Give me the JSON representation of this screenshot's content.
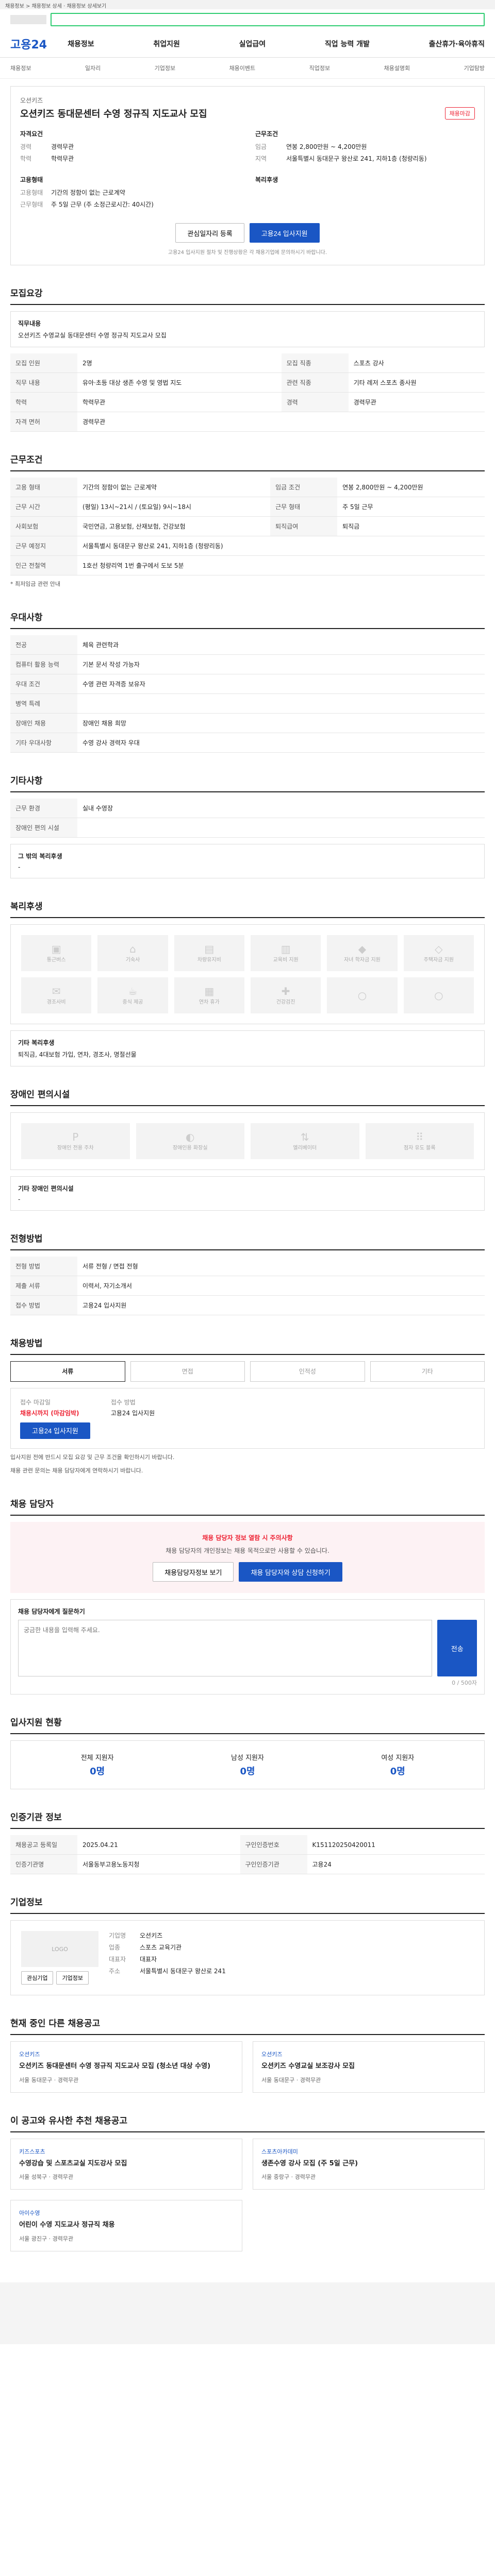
{
  "topbar": {
    "text": "채용정보 > 채용정보 상세 · 채용정보 상세보기"
  },
  "search": {
    "placeholder": ""
  },
  "gnb": {
    "brand": "고용24",
    "menu": [
      "채용정보",
      "취업지원",
      "실업급여",
      "직업 능력 개발",
      "출산휴가·육아휴직"
    ]
  },
  "subnav": [
    "채용정보",
    "일자리",
    "기업정보",
    "채용이벤트",
    "직업정보",
    "채용설명회",
    "기업탐방"
  ],
  "job": {
    "company": "오션키즈",
    "title": "오션키즈 동대문센터 수영 정규직 지도교사 모집",
    "badge": "채용마감",
    "left_heading": "자격요건",
    "left": [
      {
        "k": "경력",
        "v": "경력무관"
      },
      {
        "k": "학력",
        "v": "학력무관"
      }
    ],
    "right_heading": "근무조건",
    "right": [
      {
        "k": "임금",
        "v": "연봉 2,800만원 ~ 4,200만원"
      },
      {
        "k": "지역",
        "v": "서울특별시 동대문구 왕산로 241, 지하1층 (청량리동)"
      }
    ],
    "left2_heading": "고용형태",
    "left2": [
      {
        "k": "고용형태",
        "v": "기간의 정함이 없는 근로계약"
      },
      {
        "k": "근무형태",
        "v": "주 5일 근무 (주 소정근로시간: 40시간)"
      }
    ],
    "right2_heading": "복리후생",
    "btn_scrap": "관심일자리 등록",
    "btn_apply": "고용24 입사지원",
    "notice": "고용24 입사지원 절차 및 진행상황은 각 채용기업에 문의하시기 바랍니다."
  },
  "recruit": {
    "heading": "모집요강",
    "job_title": "직무내용",
    "job_desc": "오션키즈 수영교실 동대문센터 수영 정규직 지도교사 모집",
    "rows": [
      {
        "k": "모집 인원",
        "v": "2명"
      },
      {
        "k": "모집 직종",
        "v": "스포츠 강사"
      },
      {
        "k": "직무 내용",
        "v": "유아·초등 대상 생존 수영 및 영법 지도"
      },
      {
        "k": "관련 직종",
        "v": "기타 레저 스포츠 종사원"
      },
      {
        "k": "학력",
        "v": "학력무관"
      },
      {
        "k": "경력",
        "v": "경력무관"
      },
      {
        "k": "자격 면허",
        "v": "경력무관"
      }
    ]
  },
  "work": {
    "heading": "근무조건",
    "rows": [
      {
        "k": "고용 형태",
        "v": "기간의 정함이 없는 근로계약"
      },
      {
        "k": "임금 조건",
        "v": "연봉 2,800만원 ~ 4,200만원"
      },
      {
        "k": "근무 시간",
        "v": "(평일) 13시~21시 / (토요일) 9시~18시"
      },
      {
        "k": "근무 형태",
        "v": "주 5일 근무"
      },
      {
        "k": "사회보험",
        "v": "국민연금, 고용보험, 산재보험, 건강보험"
      },
      {
        "k": "퇴직급여",
        "v": "퇴직금"
      },
      {
        "k": "근무 예정지",
        "v": "서울특별시 동대문구 왕산로 241, 지하1층 (청량리동)"
      },
      {
        "k": "인근 전철역",
        "v": "1호선 청량리역 1번 출구에서 도보 5분"
      }
    ],
    "note": "* 최저임금 관련 안내"
  },
  "prefer": {
    "heading": "우대사항",
    "rows": [
      {
        "k": "전공",
        "v": "체육 관련학과"
      },
      {
        "k": "컴퓨터 활용 능력",
        "v": "기본 문서 작성 가능자"
      },
      {
        "k": "우대 조건",
        "v": "수영 관련 자격증 보유자"
      },
      {
        "k": "병역 특례",
        "v": ""
      },
      {
        "k": "장애인 채용",
        "v": "장애인 채용 희망"
      },
      {
        "k": "기타 우대사항",
        "v": "수영 강사 경력자 우대"
      }
    ]
  },
  "other": {
    "heading": "기타사항",
    "rows": [
      {
        "k": "근무 환경",
        "v": "실내 수영장"
      },
      {
        "k": "장애인 편의 시설",
        "v": ""
      }
    ],
    "extra_title": "그 밖의 복리후생",
    "extra_value": "-"
  },
  "welfare": {
    "heading": "복리후생",
    "items": [
      "통근버스",
      "기숙사",
      "차량유지비",
      "교육비 지원",
      "자녀 학자금 지원",
      "주택자금 지원",
      "경조사비",
      "중식 제공",
      "연차 휴가",
      "건강검진",
      "",
      ""
    ],
    "extra_title": "기타 복리후생",
    "extra_value": "퇴직금, 4대보험 가입, 연차, 경조사, 명절선물"
  },
  "disability": {
    "heading": "장애인 편의시설",
    "items": [
      "장애인 전용 주차",
      "장애인용 화장실",
      "엘리베이터",
      "점자 유도 블록"
    ],
    "extra_title": "기타 장애인 편의시설",
    "extra_value": "-"
  },
  "process": {
    "heading": "전형방법",
    "rows": [
      {
        "k": "전형 방법",
        "v": "서류 전형 / 면접 전형"
      },
      {
        "k": "제출 서류",
        "v": "이력서, 자기소개서"
      },
      {
        "k": "접수 방법",
        "v": "고용24 입사지원"
      }
    ]
  },
  "apply": {
    "heading": "채용방법",
    "tabs": [
      "서류",
      "면접",
      "인적성",
      "기타"
    ],
    "deadline_label": "접수 마감일",
    "deadline_value": "채용시까지 (마감임박)",
    "method_label": "접수 방법",
    "method_value": "고용24 입사지원",
    "apply_btn": "고용24 입사지원",
    "bullets": [
      "입사지원 전에 반드시 모집 요강 및 근무 조건을 확인하시기 바랍니다.",
      "채용 관련 문의는 채용 담당자에게 연락하시기 바랍니다."
    ]
  },
  "contact": {
    "heading": "채용 담당자",
    "warn_title": "채용 담당자 정보 열람 시 주의사항",
    "warn_text": "채용 담당자의 개인정보는 채용 목적으로만 사용할 수 있습니다.",
    "btn1": "채용담당자정보 보기",
    "btn2": "채용 담당자와 상담 신청하기",
    "qa_title": "채용 담당자에게 질문하기",
    "qa_placeholder": "궁금한 내용을 입력해 주세요.",
    "qa_btn": "전송",
    "qa_count": "0 / 500자"
  },
  "stats": {
    "heading": "입사지원 현황",
    "items": [
      {
        "label": "전체 지원자",
        "n": "0명"
      },
      {
        "label": "남성 지원자",
        "n": "0명"
      },
      {
        "label": "여성 지원자",
        "n": "0명"
      }
    ]
  },
  "meta": {
    "heading": "인증기관 정보",
    "rows": [
      {
        "k": "채용공고 등록일",
        "v": "2025.04.21"
      },
      {
        "k": "구인인증번호",
        "v": "K151120250420011"
      },
      {
        "k": "인증기관명",
        "v": "서울동부고용노동지청"
      },
      {
        "k": "구인인증기관",
        "v": "고용24"
      }
    ]
  },
  "company": {
    "heading": "기업정보",
    "logo_text": "LOGO",
    "btn_follow": "관심기업",
    "btn_view": "기업정보",
    "rows": [
      {
        "k": "기업명",
        "v": "오션키즈"
      },
      {
        "k": "업종",
        "v": "스포츠 교육기관"
      },
      {
        "k": "대표자",
        "v": "대표자"
      },
      {
        "k": "주소",
        "v": "서울특별시 동대문구 왕산로 241"
      }
    ]
  },
  "similar": {
    "heading": "현재 중인 다른 채용공고",
    "cards": [
      {
        "company": "오션키즈",
        "title": "오션키즈 동대문센터 수영 정규직 지도교사 모집 (청소년 대상 수영)",
        "meta": "서울 동대문구 · 경력무관"
      },
      {
        "company": "오션키즈",
        "title": "오션키즈 수영교실 보조강사 모집",
        "meta": "서울 동대문구 · 경력무관"
      }
    ]
  },
  "recommend": {
    "heading": "이 공고와 유사한 추천 채용공고",
    "cards": [
      {
        "company": "키즈스포츠",
        "title": "수영강습 및 스포츠교실 지도강사 모집",
        "meta": "서울 성북구 · 경력무관"
      },
      {
        "company": "스포츠아카데미",
        "title": "생존수영 강사 모집 (주 5일 근무)",
        "meta": "서울 중랑구 · 경력무관"
      },
      {
        "company": "아이수영",
        "title": "어린이 수영 지도교사 정규직 채용",
        "meta": "서울 광진구 · 경력무관"
      }
    ]
  }
}
